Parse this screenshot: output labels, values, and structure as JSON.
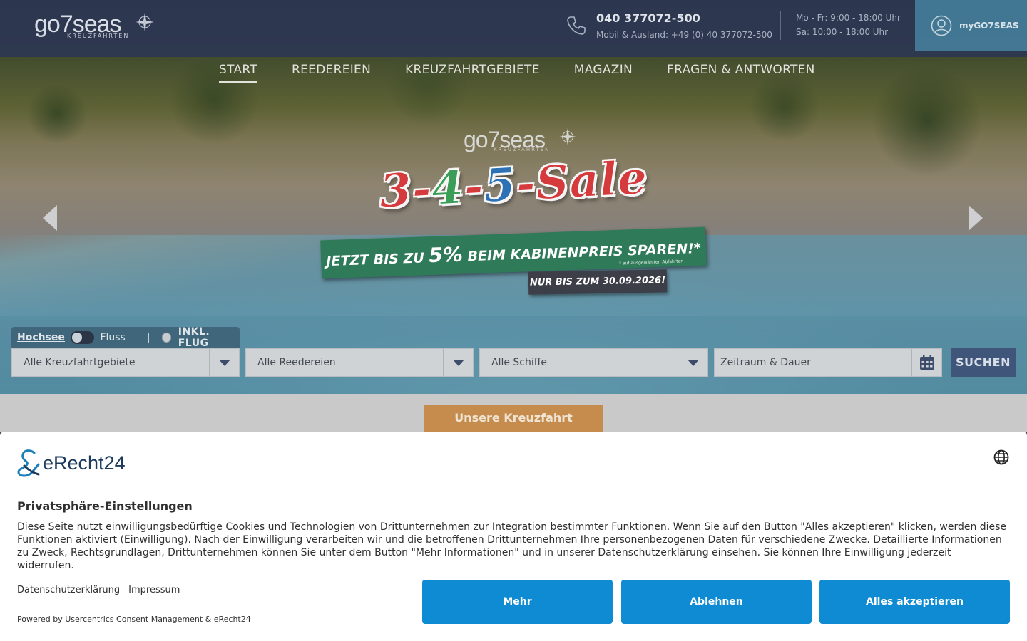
{
  "header": {
    "logo_text": "go7seas",
    "logo_sub": "KREUZFAHRTEN",
    "phone_main": "040 377072-500",
    "phone_sub": "Mobil & Ausland: +49 (0) 40 377072-500",
    "hours_weekday": "Mo - Fr: 9:00 - 18:00 Uhr",
    "hours_saturday": "Sa: 10:00 - 18:00 Uhr",
    "account_label": "myGO7SEAS"
  },
  "nav": {
    "items": [
      {
        "label": "START",
        "active": true
      },
      {
        "label": "REEDEREIEN",
        "active": false
      },
      {
        "label": "KREUZFAHRTGEBIETE",
        "active": false
      },
      {
        "label": "MAGAZIN",
        "active": false
      },
      {
        "label": "FRAGEN & ANTWORTEN",
        "active": false
      }
    ]
  },
  "promo": {
    "logo_text": "go7seas",
    "logo_sub": "KREUZFAHRTEN",
    "sale_parts": [
      "3",
      "-",
      "4",
      "-",
      "5",
      "-Sale"
    ],
    "band_pre": "JETZT BIS ZU ",
    "band_big": "5%",
    "band_post": " BEIM KABINENPREIS SPAREN!*",
    "band_note": "* auf ausgewählten Abfahrten",
    "date_text": "NUR BIS ZUM 30.09.2026!"
  },
  "search": {
    "mode_ocean": "Hochsee",
    "mode_river": "Fluss",
    "separator": "|",
    "incl_flight": "INKL. FLUG",
    "field_regions": "Alle Kreuzfahrtgebiete",
    "field_lines": "Alle Reedereien",
    "field_ships": "Alle Schiffe",
    "field_period": "Zeitraum & Dauer",
    "button": "SUCHEN"
  },
  "offers_button": "Unsere Kreuzfahrt Angebote",
  "consent": {
    "brand": "eRecht24",
    "title": "Privatsphäre-Einstellungen",
    "text": "Diese Seite nutzt einwilligungsbedürftige Cookies und Technologien von Drittunternehmen zur Integration bestimmter Funktionen. Wenn Sie auf den Button \"Alles akzeptieren\" klicken, werden diese Funktionen aktiviert (Einwilligung). Nach der Einwilligung verarbeiten wir und die betroffenen Drittunternehmen Ihre personenbezogenen Daten für verschiedene Zwecke. Detaillierte Informationen zu Zweck, Rechtsgrundlagen, Drittunternehmen können Sie unter dem Button \"Mehr Informationen\" und in unserer Datenschutzerklärung einsehen. Sie können Ihre Einwilligung jederzeit widerrufen.",
    "link_privacy": "Datenschutzerklärung",
    "link_imprint": "Impressum",
    "powered": "Powered by Usercentrics Consent Management & eRecht24",
    "btn_more": "Mehr",
    "btn_decline": "Ablehnen",
    "btn_accept": "Alles akzeptieren"
  },
  "colors": {
    "header_bg": "#2c3652",
    "account_bg": "#4682a0",
    "search_button": "#3f5579",
    "offers_button": "#c68c4d",
    "consent_button": "#0e8bd2"
  }
}
